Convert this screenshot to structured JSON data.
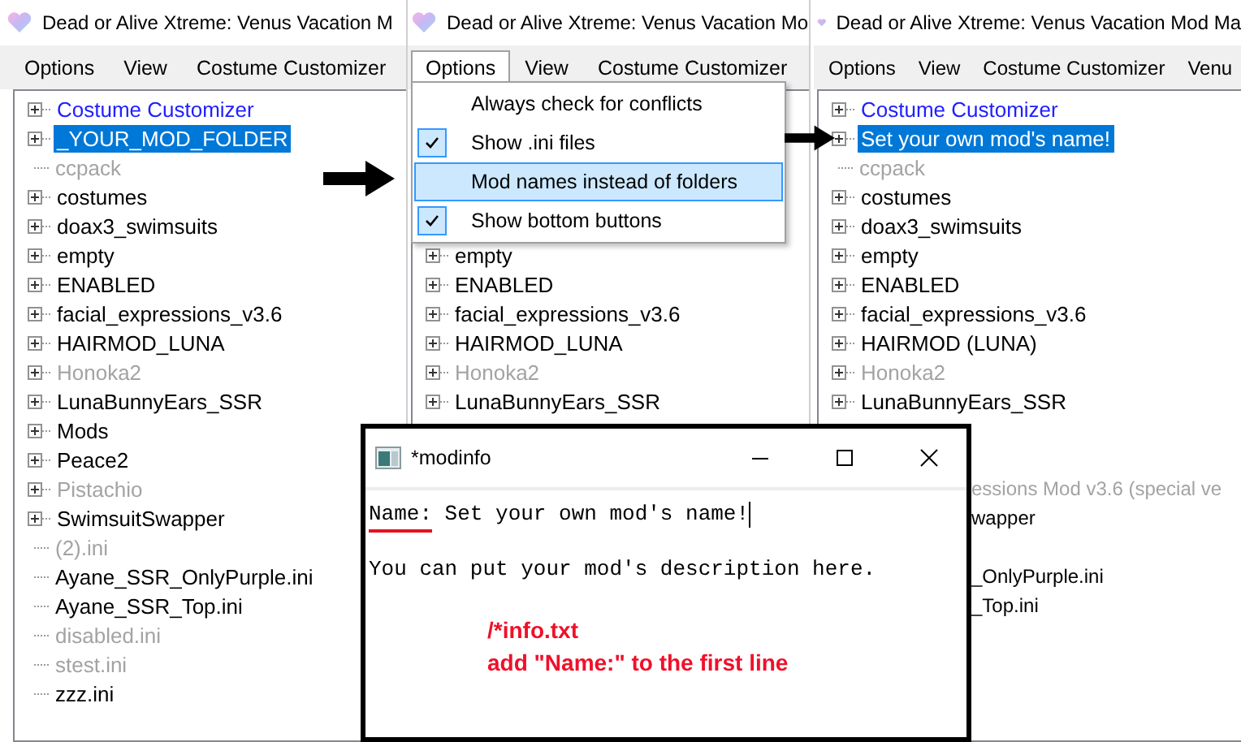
{
  "panels": [
    {
      "title": "Dead or Alive Xtreme: Venus Vacation M",
      "menu": [
        {
          "label": "Options",
          "open": false
        },
        {
          "label": "View",
          "open": false
        },
        {
          "label": "Costume Customizer",
          "open": false
        }
      ],
      "tree": [
        {
          "text": "Costume Customizer",
          "kind": "folder",
          "selected": false,
          "disabled": false,
          "color": "#2020ff"
        },
        {
          "text": "_YOUR_MOD_FOLDER",
          "kind": "folder",
          "selected": true,
          "disabled": false
        },
        {
          "text": "ccpack",
          "kind": "leaf",
          "selected": false,
          "disabled": true
        },
        {
          "text": "costumes",
          "kind": "folder",
          "selected": false,
          "disabled": false
        },
        {
          "text": "doax3_swimsuits",
          "kind": "folder",
          "selected": false,
          "disabled": false
        },
        {
          "text": "empty",
          "kind": "folder",
          "selected": false,
          "disabled": false
        },
        {
          "text": "ENABLED",
          "kind": "folder",
          "selected": false,
          "disabled": false
        },
        {
          "text": "facial_expressions_v3.6",
          "kind": "folder",
          "selected": false,
          "disabled": false
        },
        {
          "text": "HAIRMOD_LUNA",
          "kind": "folder",
          "selected": false,
          "disabled": false
        },
        {
          "text": "Honoka2",
          "kind": "folder",
          "selected": false,
          "disabled": true
        },
        {
          "text": "LunaBunnyEars_SSR",
          "kind": "folder",
          "selected": false,
          "disabled": false
        },
        {
          "text": "Mods",
          "kind": "folder",
          "selected": false,
          "disabled": false
        },
        {
          "text": "Peace2",
          "kind": "folder",
          "selected": false,
          "disabled": false
        },
        {
          "text": "Pistachio",
          "kind": "folder",
          "selected": false,
          "disabled": true
        },
        {
          "text": "SwimsuitSwapper",
          "kind": "folder",
          "selected": false,
          "disabled": false
        },
        {
          "text": "(2).ini",
          "kind": "leaf",
          "selected": false,
          "disabled": true
        },
        {
          "text": "Ayane_SSR_OnlyPurple.ini",
          "kind": "leaf",
          "selected": false,
          "disabled": false
        },
        {
          "text": "Ayane_SSR_Top.ini",
          "kind": "leaf",
          "selected": false,
          "disabled": false
        },
        {
          "text": "disabled.ini",
          "kind": "leaf",
          "selected": false,
          "disabled": true
        },
        {
          "text": "stest.ini",
          "kind": "leaf",
          "selected": false,
          "disabled": true
        },
        {
          "text": "zzz.ini",
          "kind": "leaf",
          "selected": false,
          "disabled": false
        }
      ]
    },
    {
      "title": "Dead or Alive Xtreme: Venus Vacation Mo",
      "menu": [
        {
          "label": "Options",
          "open": true
        },
        {
          "label": "View",
          "open": false
        },
        {
          "label": "Costume Customizer",
          "open": false
        }
      ],
      "dropdown": [
        {
          "label": "Always check for conflicts",
          "checked": false,
          "selected": false
        },
        {
          "label": "Show .ini files",
          "checked": true,
          "selected": false
        },
        {
          "label": "Mod names instead of folders",
          "checked": false,
          "selected": true
        },
        {
          "label": "Show bottom buttons",
          "checked": true,
          "selected": false
        }
      ],
      "tree": [
        {
          "text": "empty",
          "kind": "folder",
          "selected": false,
          "disabled": false
        },
        {
          "text": "ENABLED",
          "kind": "folder",
          "selected": false,
          "disabled": false
        },
        {
          "text": "facial_expressions_v3.6",
          "kind": "folder",
          "selected": false,
          "disabled": false
        },
        {
          "text": "HAIRMOD_LUNA",
          "kind": "folder",
          "selected": false,
          "disabled": false
        },
        {
          "text": "Honoka2",
          "kind": "folder",
          "selected": false,
          "disabled": true
        },
        {
          "text": "LunaBunnyEars_SSR",
          "kind": "folder",
          "selected": false,
          "disabled": false
        }
      ]
    },
    {
      "title": "Dead or Alive Xtreme: Venus Vacation Mod Ma",
      "menu": [
        {
          "label": "Options",
          "open": false
        },
        {
          "label": "View",
          "open": false
        },
        {
          "label": "Costume Customizer",
          "open": false
        },
        {
          "label": "Venu",
          "open": false
        }
      ],
      "tree": [
        {
          "text": "Costume Customizer",
          "kind": "folder",
          "selected": false,
          "disabled": false,
          "color": "#2020ff"
        },
        {
          "text": "Set your own mod's name!",
          "kind": "folder",
          "selected": true,
          "disabled": false
        },
        {
          "text": "ccpack",
          "kind": "leaf",
          "selected": false,
          "disabled": true
        },
        {
          "text": "costumes",
          "kind": "folder",
          "selected": false,
          "disabled": false
        },
        {
          "text": "doax3_swimsuits",
          "kind": "folder",
          "selected": false,
          "disabled": false
        },
        {
          "text": "empty",
          "kind": "folder",
          "selected": false,
          "disabled": false
        },
        {
          "text": "ENABLED",
          "kind": "folder",
          "selected": false,
          "disabled": false
        },
        {
          "text": "facial_expressions_v3.6",
          "kind": "folder",
          "selected": false,
          "disabled": false
        },
        {
          "text": "HAIRMOD (LUNA)",
          "kind": "folder",
          "selected": false,
          "disabled": false
        },
        {
          "text": "Honoka2",
          "kind": "folder",
          "selected": false,
          "disabled": true
        },
        {
          "text": "LunaBunnyEars_SSR",
          "kind": "folder",
          "selected": false,
          "disabled": false
        },
        {
          "kind": "gap"
        },
        {
          "kind": "gap"
        },
        {
          "text": "essions Mod v3.6 (special ve",
          "kind": "fragment",
          "selected": false,
          "disabled": true
        },
        {
          "text": "wapper",
          "kind": "fragment",
          "selected": false,
          "disabled": false
        },
        {
          "kind": "gap"
        },
        {
          "text": "_OnlyPurple.ini",
          "kind": "fragment",
          "selected": false,
          "disabled": false
        },
        {
          "text": "_Top.ini",
          "kind": "fragment",
          "selected": false,
          "disabled": false
        }
      ]
    }
  ],
  "notepad": {
    "title": "*modinfo",
    "key": "Name:",
    "value": " Set your own mod's name!",
    "description": "You can put your mod's description here.",
    "notes": [
      "/*info.txt",
      "add \"Name:\" to the first line"
    ]
  }
}
